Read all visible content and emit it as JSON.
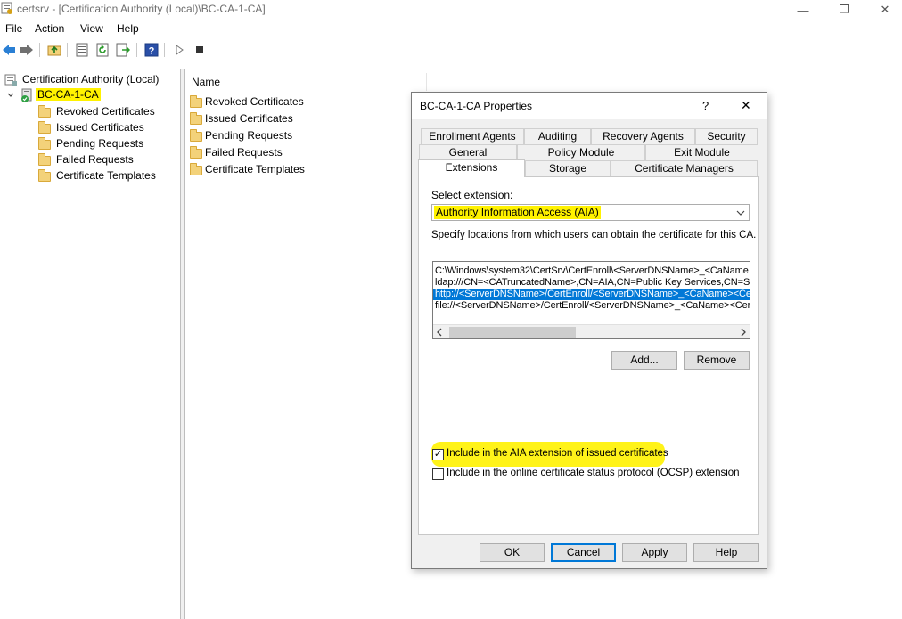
{
  "window": {
    "title": "certsrv - [Certification Authority (Local)\\BC-CA-1-CA]",
    "minimize_glyph": "—",
    "restore_glyph": "❐",
    "close_glyph": "✕"
  },
  "menu": {
    "file": "File",
    "action": "Action",
    "view": "View",
    "help": "Help"
  },
  "toolbar": {
    "icons": [
      "back-icon",
      "forward-icon",
      "up-folder-icon",
      "properties-icon",
      "refresh-icon",
      "export-list-icon",
      "help-icon",
      "start-service-icon",
      "stop-service-icon"
    ]
  },
  "tree": {
    "root": "Certification Authority (Local)",
    "ca_node": "BC-CA-1-CA",
    "children": [
      "Revoked Certificates",
      "Issued Certificates",
      "Pending Requests",
      "Failed Requests",
      "Certificate Templates"
    ]
  },
  "list": {
    "column_name": "Name",
    "items": [
      "Revoked Certificates",
      "Issued Certificates",
      "Pending Requests",
      "Failed Requests",
      "Certificate Templates"
    ]
  },
  "dialog": {
    "title": "BC-CA-1-CA Properties",
    "help_glyph": "?",
    "close_glyph": "✕",
    "tabs_row1": [
      "Enrollment Agents",
      "Auditing",
      "Recovery Agents",
      "Security"
    ],
    "tabs_row2": [
      "General",
      "Policy Module",
      "Exit Module"
    ],
    "tabs_row3": [
      "Extensions",
      "Storage",
      "Certificate Managers"
    ],
    "active_tab": "Extensions",
    "select_extension_label": "Select extension:",
    "selected_extension": "Authority Information Access (AIA)",
    "description": "Specify locations from which users can obtain the certificate for this CA.",
    "locations": [
      "C:\\Windows\\system32\\CertSrv\\CertEnroll\\<ServerDNSName>_<CaName",
      "ldap:///CN=<CATruncatedName>,CN=AIA,CN=Public Key Services,CN=S",
      "http://<ServerDNSName>/CertEnroll/<ServerDNSName>_<CaName><Ce",
      "file://<ServerDNSName>/CertEnroll/<ServerDNSName>_<CaName><Cert"
    ],
    "selected_location_index": 2,
    "add_button": "Add...",
    "remove_button": "Remove",
    "checkbox_aia_label": "Include in the AIA extension of issued certificates",
    "checkbox_aia_checked": true,
    "checkbox_ocsp_label": "Include in the online certificate status protocol (OCSP) extension",
    "checkbox_ocsp_checked": false,
    "ok_button": "OK",
    "cancel_button": "Cancel",
    "apply_button": "Apply",
    "help_button": "Help"
  },
  "colors": {
    "highlight": "#fff200",
    "selection": "#0078d7",
    "folder": "#f3d27a"
  }
}
